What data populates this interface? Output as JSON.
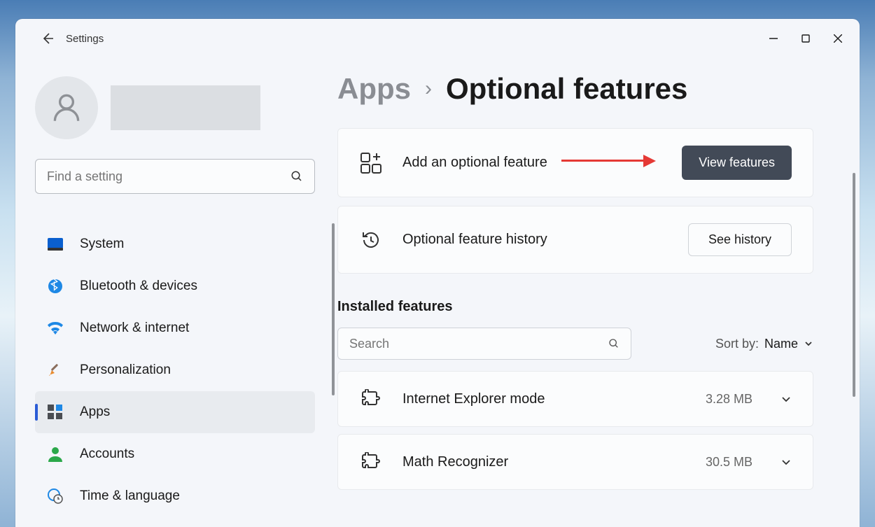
{
  "window": {
    "app_title": "Settings"
  },
  "search": {
    "placeholder": "Find a setting"
  },
  "nav": {
    "items": [
      {
        "label": "System"
      },
      {
        "label": "Bluetooth & devices"
      },
      {
        "label": "Network & internet"
      },
      {
        "label": "Personalization"
      },
      {
        "label": "Apps"
      },
      {
        "label": "Accounts"
      },
      {
        "label": "Time & language"
      }
    ]
  },
  "breadcrumb": {
    "root": "Apps",
    "leaf": "Optional features"
  },
  "add_feature": {
    "label": "Add an optional feature",
    "button": "View features"
  },
  "history": {
    "label": "Optional feature history",
    "button": "See history"
  },
  "installed": {
    "title": "Installed features",
    "search_placeholder": "Search",
    "sort_label": "Sort by:",
    "sort_value": "Name",
    "items": [
      {
        "name": "Internet Explorer mode",
        "size": "3.28 MB"
      },
      {
        "name": "Math Recognizer",
        "size": "30.5 MB"
      }
    ]
  }
}
